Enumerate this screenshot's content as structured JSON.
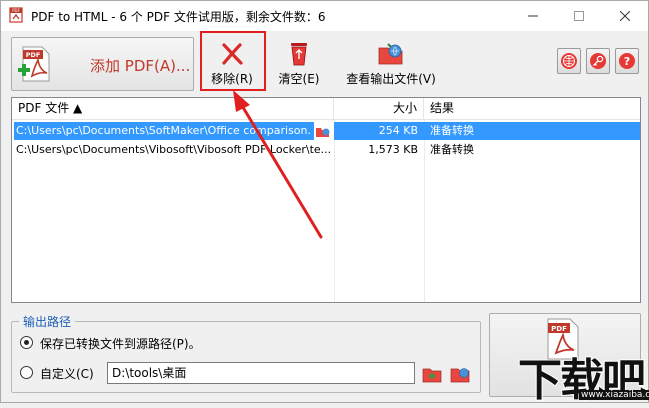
{
  "window": {
    "title": "PDF to HTML - 6 个 PDF 文件试用版，剩余文件数：6"
  },
  "toolbar": {
    "add_label": "添加 PDF(A)...",
    "remove_label": "移除(R)",
    "clear_label": "清空(E)",
    "view_output_label": "查看输出文件(V)"
  },
  "file_list": {
    "columns": [
      "PDF 文件 ▲",
      "大小",
      "结果"
    ],
    "rows": [
      {
        "file": "C:\\Users\\pc\\Documents\\SoftMaker\\Office comparison.",
        "size": "254 KB",
        "result": "准备转换",
        "selected": true
      },
      {
        "file": "C:\\Users\\pc\\Documents\\Vibosoft\\Vibosoft PDF Locker\\te...",
        "size": "1,573 KB",
        "result": "准备转换",
        "selected": false
      }
    ]
  },
  "output": {
    "group_title": "输出路径",
    "option_source_label": "保存已转换文件到源路径(P)。",
    "option_custom_label": "自定义(C)",
    "custom_path_value": "D:\\tools\\桌面",
    "selected_option": "source"
  },
  "watermark": {
    "text": "下载吧",
    "url": "www.xiazaiba.com"
  },
  "icons": {
    "app": "pdf-to-html-app-icon",
    "add": "pdf-add-icon",
    "remove": "red-x-icon",
    "clear": "recycle-bin-icon",
    "view_output": "folder-icon",
    "web": "globe-icon",
    "register": "key-icon",
    "help": "help-icon",
    "convert": "pdf-convert-icon"
  },
  "colors": {
    "accent_red": "#e02020",
    "selection_blue": "#3399ff",
    "group_title_blue": "#1e5fb4"
  }
}
